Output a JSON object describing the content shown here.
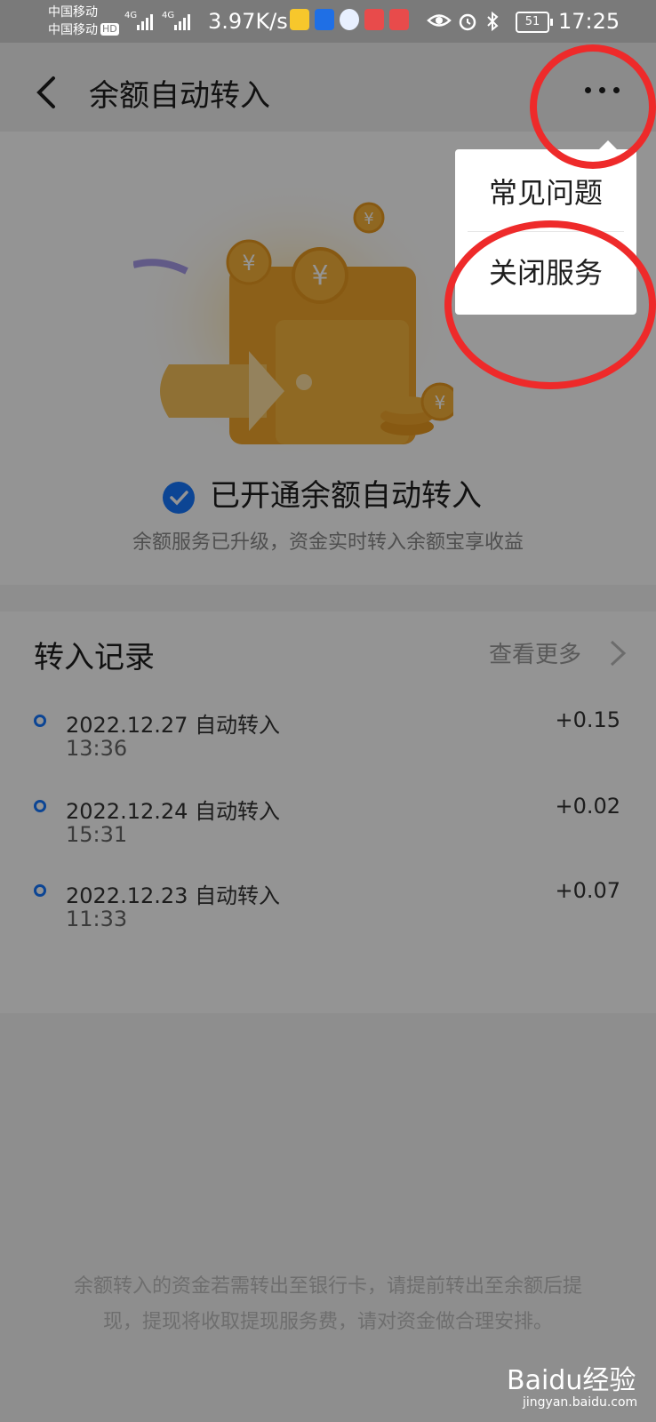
{
  "status_bar": {
    "carrier1": "中国移动",
    "carrier2": "中国移动",
    "hd_badge": "HD",
    "net1": "4G",
    "net2": "4G",
    "speed": "3.97K/s",
    "battery": "51",
    "time": "17:25",
    "icons": [
      "weibo-icon",
      "bulb-icon",
      "browser-icon",
      "huawei-icon",
      "book-icon",
      "eye-icon",
      "alarm-icon",
      "bluetooth-icon"
    ]
  },
  "header": {
    "title": "余额自动转入",
    "back_icon": "chevron-left-icon",
    "more_icon": "more-icon"
  },
  "hero": {
    "status_text": "已开通余额自动转入",
    "status_desc": "余额服务已升级，资金实时转入余额宝享收益"
  },
  "records": {
    "title": "转入记录",
    "view_more": "查看更多",
    "items": [
      {
        "date": "2022.12.27",
        "type": "自动转入",
        "time": "13:36",
        "amount": "+0.15"
      },
      {
        "date": "2022.12.24",
        "type": "自动转入",
        "time": "15:31",
        "amount": "+0.02"
      },
      {
        "date": "2022.12.23",
        "type": "自动转入",
        "time": "11:33",
        "amount": "+0.07"
      }
    ]
  },
  "footer_note": "余额转入的资金若需转出至银行卡，请提前转出至余额后提现，提现将收取提现服务费，请对资金做合理安排。",
  "menu": {
    "items": [
      "常见问题",
      "关闭服务"
    ]
  },
  "watermark": {
    "brand": "Baidu经验",
    "url": "jingyan.baidu.com"
  },
  "colors": {
    "accent": "#1677ff",
    "annotation": "#ee2a2a"
  }
}
